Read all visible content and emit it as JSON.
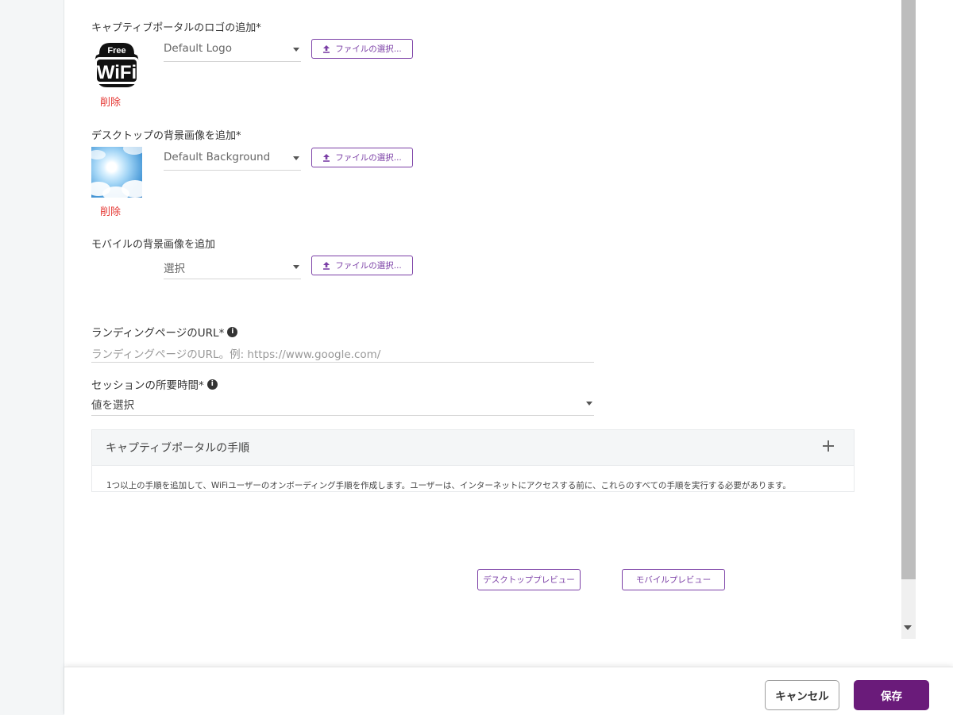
{
  "sections": {
    "logo": {
      "label": "キャプティブポータルのロゴの追加*",
      "logo_text_top": "Free",
      "logo_text_main": "WiFi",
      "select_value": "Default Logo",
      "file_button": "ファイルの選択...",
      "delete": "削除"
    },
    "desktop_bg": {
      "label": "デスクトップの背景画像を追加*",
      "select_value": "Default Background",
      "file_button": "ファイルの選択...",
      "delete": "削除"
    },
    "mobile_bg": {
      "label": "モバイルの背景画像を追加",
      "select_value": "選択",
      "file_button": "ファイルの選択..."
    }
  },
  "landing_url": {
    "label": "ランディングページのURL*",
    "placeholder": "ランディングページのURL。例: https://www.google.com/"
  },
  "session_duration": {
    "label": "セッションの所要時間*",
    "value": "値を選択"
  },
  "portal_steps": {
    "title": "キャプティブポータルの手順",
    "description": "1つ以上の手順を追加して、WiFiユーザーのオンボーディング手順を作成します。ユーザーは、インターネットにアクセスする前に、これらのすべての手順を実行する必要があります。"
  },
  "preview": {
    "desktop": "デスクトッププレビュー",
    "mobile": "モバイルプレビュー"
  },
  "footer": {
    "cancel": "キャンセル",
    "save": "保存"
  },
  "colors": {
    "accent": "#7b3fa6",
    "primary_button": "#6a1b7a",
    "delete": "#e53935"
  }
}
